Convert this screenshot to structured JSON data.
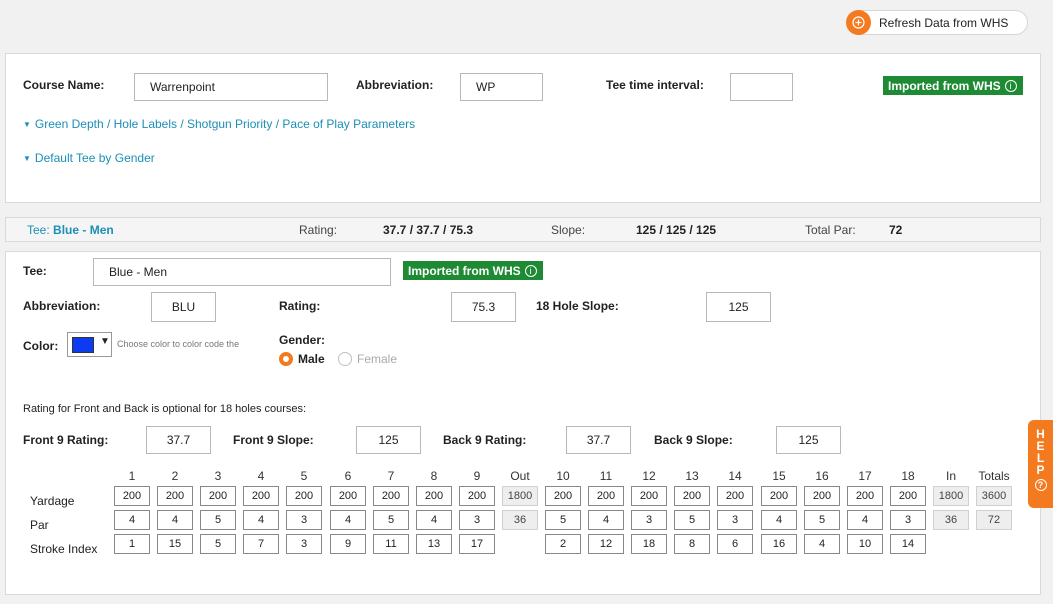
{
  "refresh": {
    "label": "Refresh Data from WHS",
    "icon": "plus-circle-icon"
  },
  "course": {
    "name_label": "Course Name:",
    "name_value": "Warrenpoint",
    "abbr_label": "Abbreviation:",
    "abbr_value": "WP",
    "tee_interval_label": "Tee time interval:",
    "tee_interval_value": "",
    "imported_badge": "Imported from WHS",
    "link_green_depth": "Green Depth / Hole Labels / Shotgun Priority / Pace of Play Parameters",
    "link_default_tee": "Default Tee by Gender"
  },
  "tee_bar": {
    "tee_label": "Tee:",
    "tee_name": "Blue - Men",
    "rating_label": "Rating:",
    "rating_value": "37.7 / 37.7 / 75.3",
    "slope_label": "Slope:",
    "slope_value": "125 / 125 / 125",
    "par_label": "Total Par:",
    "par_value": "72"
  },
  "tee": {
    "tee_label": "Tee:",
    "tee_value": "Blue - Men",
    "imported_badge": "Imported from WHS",
    "abbr_label": "Abbreviation:",
    "abbr_value": "BLU",
    "rating_label": "Rating:",
    "rating_value": "75.3",
    "slope_label": "18 Hole Slope:",
    "slope_value": "125",
    "color_label": "Color:",
    "color_hex": "#0d3bf2",
    "color_hint": "Choose color to color code the",
    "gender_label": "Gender:",
    "gender_male": "Male",
    "gender_female": "Female",
    "gender_selected": "Male",
    "optional_note": "Rating for Front and Back is optional for 18 holes courses:",
    "front_rating_label": "Front 9 Rating:",
    "front_rating_value": "37.7",
    "front_slope_label": "Front 9 Slope:",
    "front_slope_value": "125",
    "back_rating_label": "Back 9 Rating:",
    "back_rating_value": "37.7",
    "back_slope_label": "Back 9 Slope:",
    "back_slope_value": "125"
  },
  "scorecard": {
    "row_labels": {
      "yardage": "Yardage",
      "par": "Par",
      "stroke_index": "Stroke Index"
    },
    "columns": [
      {
        "header": "1",
        "yardage": "200",
        "par": "4",
        "si": "1"
      },
      {
        "header": "2",
        "yardage": "200",
        "par": "4",
        "si": "15"
      },
      {
        "header": "3",
        "yardage": "200",
        "par": "5",
        "si": "5"
      },
      {
        "header": "4",
        "yardage": "200",
        "par": "4",
        "si": "7"
      },
      {
        "header": "5",
        "yardage": "200",
        "par": "3",
        "si": "3"
      },
      {
        "header": "6",
        "yardage": "200",
        "par": "4",
        "si": "9"
      },
      {
        "header": "7",
        "yardage": "200",
        "par": "5",
        "si": "11"
      },
      {
        "header": "8",
        "yardage": "200",
        "par": "4",
        "si": "13"
      },
      {
        "header": "9",
        "yardage": "200",
        "par": "3",
        "si": "17"
      },
      {
        "header": "Out",
        "yardage": "1800",
        "par": "36",
        "si": "",
        "total": true
      },
      {
        "header": "10",
        "yardage": "200",
        "par": "5",
        "si": "2"
      },
      {
        "header": "11",
        "yardage": "200",
        "par": "4",
        "si": "12"
      },
      {
        "header": "12",
        "yardage": "200",
        "par": "3",
        "si": "18"
      },
      {
        "header": "13",
        "yardage": "200",
        "par": "5",
        "si": "8"
      },
      {
        "header": "14",
        "yardage": "200",
        "par": "3",
        "si": "6"
      },
      {
        "header": "15",
        "yardage": "200",
        "par": "4",
        "si": "16"
      },
      {
        "header": "16",
        "yardage": "200",
        "par": "5",
        "si": "4"
      },
      {
        "header": "17",
        "yardage": "200",
        "par": "4",
        "si": "10"
      },
      {
        "header": "18",
        "yardage": "200",
        "par": "3",
        "si": "14"
      },
      {
        "header": "In",
        "yardage": "1800",
        "par": "36",
        "si": "",
        "total": true
      },
      {
        "header": "Totals",
        "yardage": "3600",
        "par": "72",
        "si": "",
        "total": true
      }
    ]
  },
  "help_tab": {
    "letters": [
      "H",
      "E",
      "L",
      "P"
    ],
    "icon": "question-circle-icon"
  }
}
